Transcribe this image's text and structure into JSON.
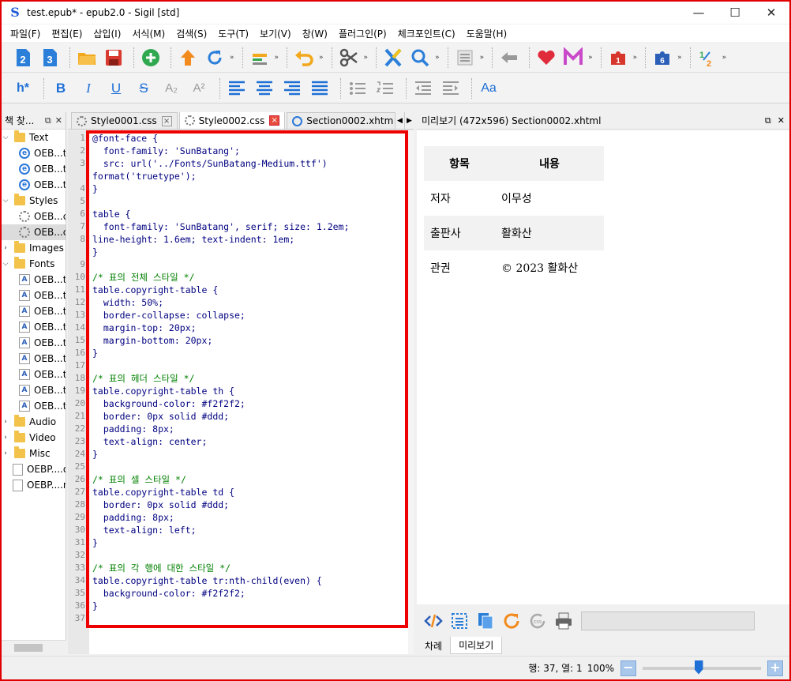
{
  "window": {
    "title": "test.epub* - epub2.0 - Sigil [std]",
    "logo": "S",
    "minimize": "—",
    "maximize": "☐",
    "close": "✕"
  },
  "menu": [
    "파일(F)",
    "편집(E)",
    "삽입(I)",
    "서식(M)",
    "검색(S)",
    "도구(T)",
    "보기(V)",
    "창(W)",
    "플러그인(P)",
    "체크포인트(C)",
    "도움말(H)"
  ],
  "toolbar": {
    "more": "»",
    "heading_label": "h*",
    "bold": "B",
    "italic": "I",
    "underline": "U",
    "strike": "S",
    "subscript": "A₂",
    "superscript": "A²",
    "font_label": "Aa"
  },
  "book_browser": {
    "title": "책 찾...",
    "items": [
      {
        "label": "Text",
        "type": "folder",
        "level": 0
      },
      {
        "label": "OEB...t",
        "type": "ie",
        "level": 1
      },
      {
        "label": "OEB...t",
        "type": "ie",
        "level": 1
      },
      {
        "label": "OEB...t",
        "type": "ie",
        "level": 1
      },
      {
        "label": "Styles",
        "type": "folder",
        "level": 0
      },
      {
        "label": "OEB...c",
        "type": "gear",
        "level": 1
      },
      {
        "label": "OEB...c",
        "type": "gear",
        "level": 1
      },
      {
        "label": "Images",
        "type": "folder",
        "level": 0
      },
      {
        "label": "Fonts",
        "type": "folder",
        "level": 0
      },
      {
        "label": "OEB...t",
        "type": "font",
        "level": 1
      },
      {
        "label": "OEB...t",
        "type": "font",
        "level": 1
      },
      {
        "label": "OEB...t",
        "type": "font",
        "level": 1
      },
      {
        "label": "OEB...t",
        "type": "font",
        "level": 1
      },
      {
        "label": "OEB...t",
        "type": "font",
        "level": 1
      },
      {
        "label": "OEB...t",
        "type": "font",
        "level": 1
      },
      {
        "label": "OEB...t",
        "type": "font",
        "level": 1
      },
      {
        "label": "OEB...t",
        "type": "font",
        "level": 1
      },
      {
        "label": "OEB...t",
        "type": "font",
        "level": 1
      },
      {
        "label": "Audio",
        "type": "folder",
        "level": 0
      },
      {
        "label": "Video",
        "type": "folder",
        "level": 0
      },
      {
        "label": "Misc",
        "type": "folder",
        "level": 0
      },
      {
        "label": "OEBP....o",
        "type": "file",
        "level": 0
      },
      {
        "label": "OEBP....n",
        "type": "file",
        "level": 0
      }
    ]
  },
  "tabs": [
    {
      "label": "Style0001.css",
      "icon": "gear",
      "active": false
    },
    {
      "label": "Style0002.css",
      "icon": "gear",
      "active": true
    },
    {
      "label": "Section0002.xhtm",
      "icon": "ie",
      "active": false
    }
  ],
  "code_lines": [
    "@font-face {",
    "  font-family: 'SunBatang';",
    "  src: url('../Fonts/SunBatang-Medium.ttf')",
    "format('truetype');",
    "}",
    "",
    "table {",
    "  font-family: 'SunBatang', serif; size: 1.2em;",
    "line-height: 1.6em; text-indent: 1em;",
    "}",
    "",
    "/* 표의 전체 스타일 */",
    "table.copyright-table {",
    "  width: 50%;",
    "  border-collapse: collapse;",
    "  margin-top: 20px;",
    "  margin-bottom: 20px;",
    "}",
    "",
    "/* 표의 헤더 스타일 */",
    "table.copyright-table th {",
    "  background-color: #f2f2f2;",
    "  border: 0px solid #ddd;",
    "  padding: 8px;",
    "  text-align: center;",
    "}",
    "",
    "/* 표의 셀 스타일 */",
    "table.copyright-table td {",
    "  border: 0px solid #ddd;",
    "  padding: 8px;",
    "  text-align: left;",
    "}",
    "",
    "/* 표의 각 행에 대한 스타일 */",
    "table.copyright-table tr:nth-child(even) {",
    "  background-color: #f2f2f2;",
    "}",
    ""
  ],
  "line_numbers": [
    "1",
    "2",
    "3",
    "",
    "4",
    "5",
    "6",
    "7",
    "8",
    "",
    "9",
    "10",
    "11",
    "12",
    "13",
    "14",
    "15",
    "16",
    "17",
    "18",
    "19",
    "20",
    "21",
    "22",
    "23",
    "24",
    "25",
    "26",
    "27",
    "28",
    "29",
    "30",
    "31",
    "32",
    "33",
    "34",
    "35",
    "36",
    "37"
  ],
  "preview": {
    "title": "미리보기 (472x596) Section0002.xhtml",
    "headers": [
      "항목",
      "내용"
    ],
    "rows": [
      [
        "저자",
        "이무성"
      ],
      [
        "출판사",
        "활화산"
      ],
      [
        "관권",
        "© 2023 활화산"
      ]
    ]
  },
  "bottom_tabs": [
    "차례",
    "미리보기"
  ],
  "status": {
    "position": "행: 37, 열: 1",
    "zoom": "100%",
    "zoom_fraction": 0.47
  },
  "colors": {
    "accent": "#1e6fd6",
    "highlight_border": "#ee0000",
    "comment": "#008000",
    "code": "#000080"
  }
}
